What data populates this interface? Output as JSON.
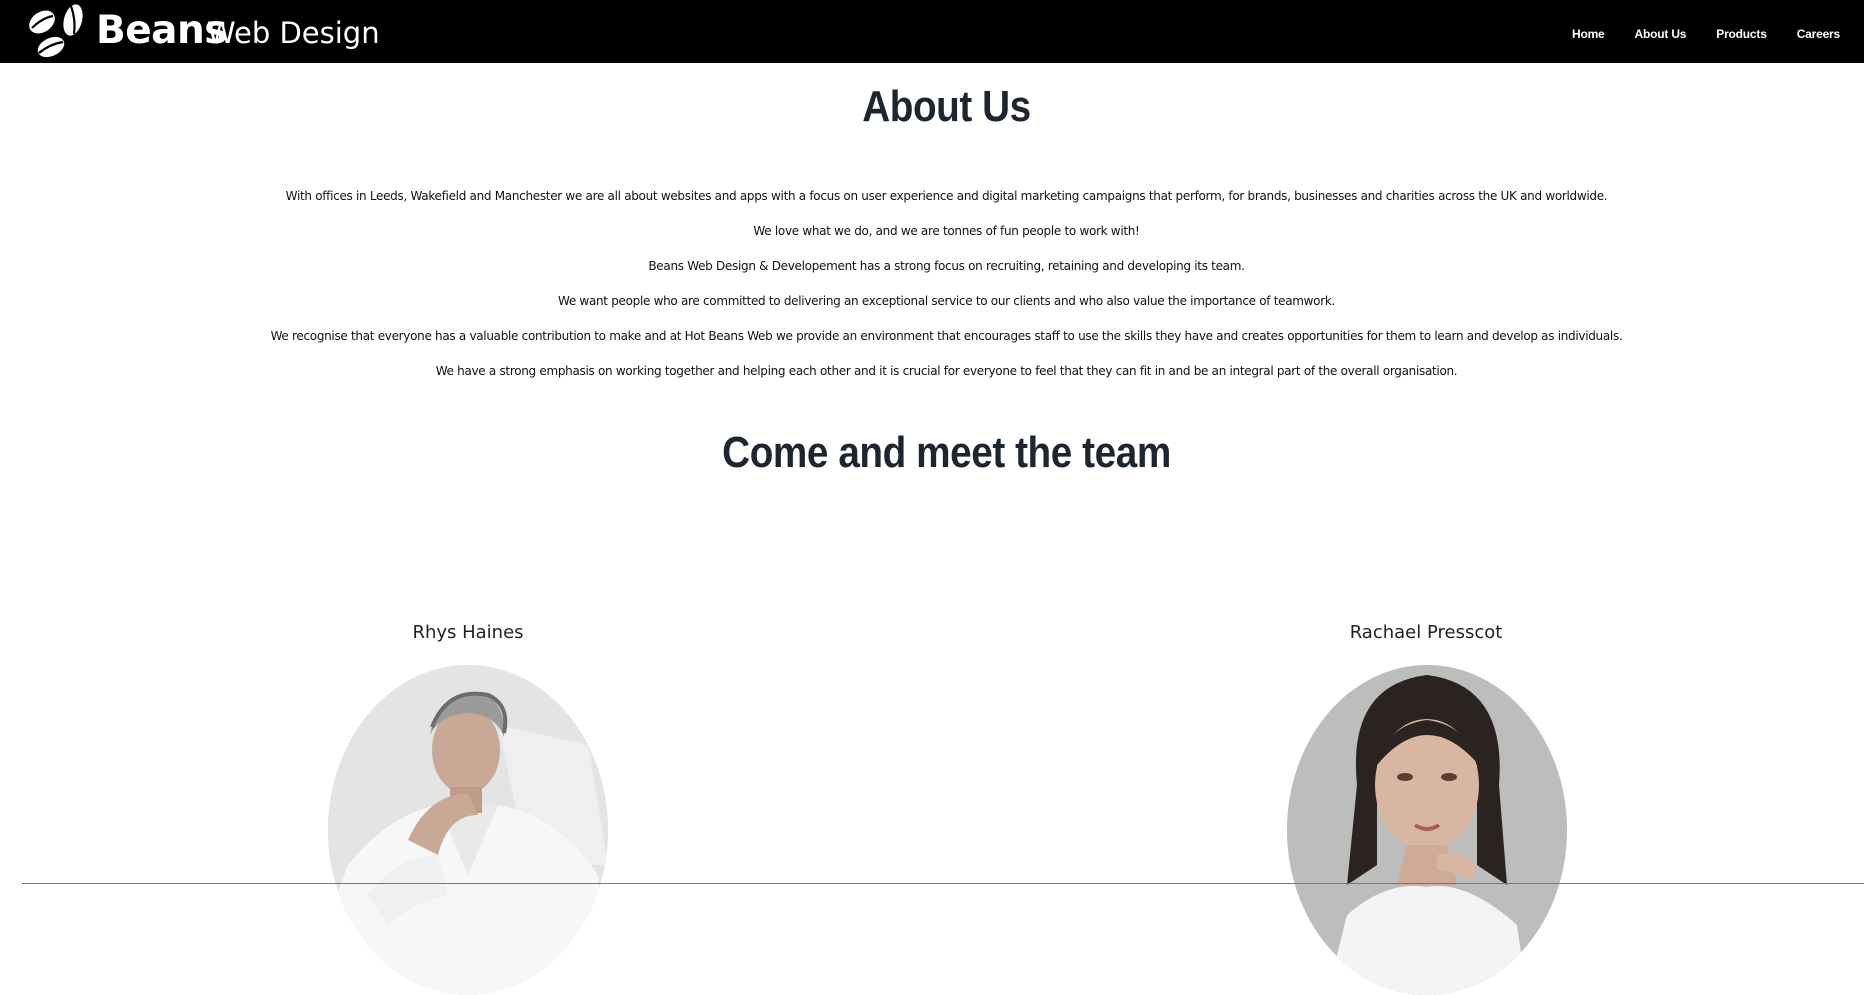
{
  "header": {
    "brand_strong": "Beans",
    "brand_light": "Web Design",
    "nav": [
      "Home",
      "About Us",
      "Products",
      "Careers"
    ]
  },
  "main": {
    "title": "About Us",
    "paragraphs": [
      "With offices in Leeds, Wakefield and Manchester we are all about websites and apps with a focus on user experience and digital marketing campaigns that perform, for brands, businesses and charities across the UK and worldwide.",
      "We love what we do, and we are tonnes of fun people to work with!",
      "Beans Web Design & Developement has a strong focus on recruiting, retaining and developing its team.",
      "We want people who are committed to delivering an exceptional service to our clients and who also value the importance of teamwork.",
      "We recognise that everyone has a valuable contribution to make and at Hot Beans Web we provide an environment that encourages staff to use the skills they have and creates opportunities for them to learn and develop as individuals.",
      "We have a strong emphasis on working together and helping each other and it is crucial for everyone to feel that they can fit in and be an integral part of the overall organisation."
    ],
    "team_title": "Come and meet the team",
    "members": [
      {
        "name": "Rhys Haines"
      },
      {
        "name": "Rachael Presscot"
      }
    ]
  },
  "colors": {
    "topbar": "#000000",
    "heading": "#1d2630",
    "background": "#ffffff"
  }
}
